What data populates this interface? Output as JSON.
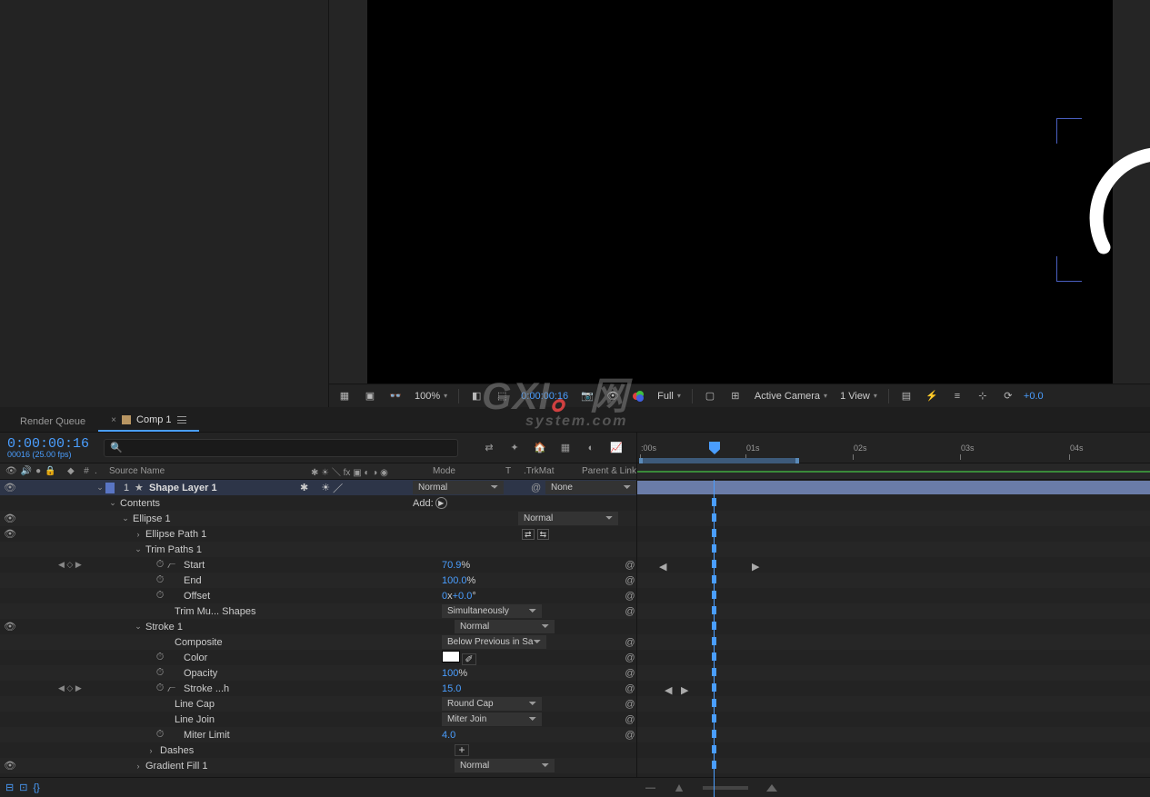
{
  "preview": {
    "zoom": "100%",
    "timecode": "0:00:00:16",
    "resolution": "Full",
    "camera": "Active Camera",
    "views": "1 View",
    "exposure": "+0.0"
  },
  "tabs": {
    "render_queue": "Render Queue",
    "comp": "Comp 1"
  },
  "timeline": {
    "current_time": "0:00:00:16",
    "frame_info": "00016 (25.00 fps)",
    "ruler": [
      ":00s",
      "01s",
      "02s",
      "03s",
      "04s"
    ]
  },
  "columns": {
    "num": "#",
    "source": "Source Name",
    "mode": "Mode",
    "t": "T",
    "trkmat": ".TrkMat",
    "parent": "Parent & Link"
  },
  "layer": {
    "num": "1",
    "name": "Shape Layer 1",
    "mode": "Normal",
    "parent": "None",
    "contents": "Contents",
    "add": "Add:",
    "ellipse": "Ellipse 1",
    "ellipse_mode": "Normal",
    "ellipse_path": "Ellipse Path 1",
    "trim_paths": "Trim Paths 1",
    "start_label": "Start",
    "start_val": "70.9",
    "start_unit": "%",
    "end_label": "End",
    "end_val": "100.0",
    "end_unit": "%",
    "offset_label": "Offset",
    "offset_val": "0",
    "offset_x": "x",
    "offset_deg": "+0.0",
    "offset_unit": "°",
    "trim_multi_label": "Trim Mu... Shapes",
    "trim_multi_val": "Simultaneously",
    "stroke": "Stroke 1",
    "stroke_mode": "Normal",
    "composite_label": "Composite",
    "composite_val": "Below Previous in Sa",
    "color_label": "Color",
    "opacity_label": "Opacity",
    "opacity_val": "100",
    "opacity_unit": "%",
    "sw_label": "Stroke ...h",
    "sw_val": "15.0",
    "linecap_label": "Line Cap",
    "linecap_val": "Round Cap",
    "linejoin_label": "Line Join",
    "linejoin_val": "Miter Join",
    "miter_label": "Miter Limit",
    "miter_val": "4.0",
    "dashes": "Dashes",
    "gradfill": "Gradient Fill 1",
    "gradfill_mode": "Normal"
  },
  "watermark": {
    "main": "GXI",
    "dot": "。",
    "net": "网",
    "sub": "system.com"
  }
}
